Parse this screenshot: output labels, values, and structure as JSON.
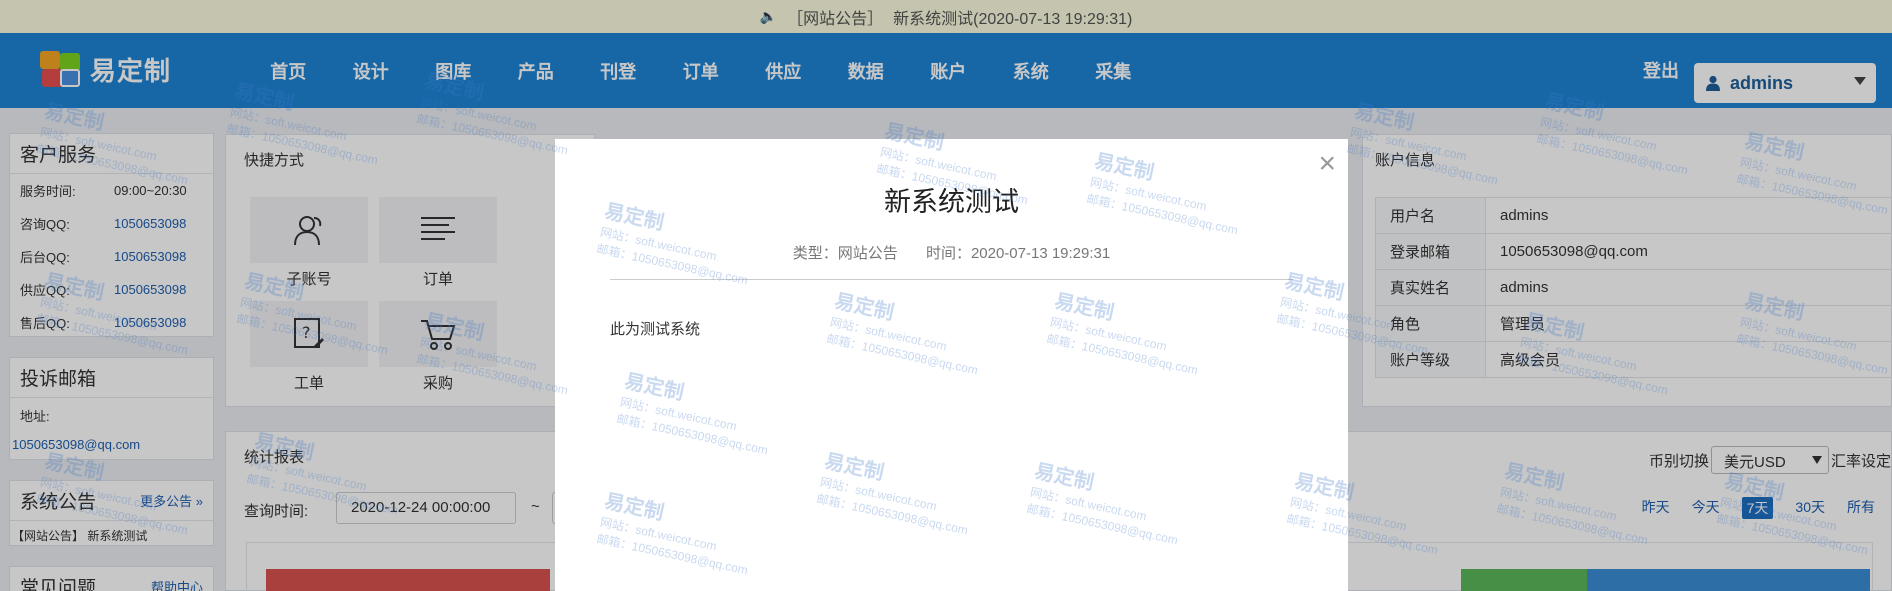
{
  "notice": {
    "tag": "［网站公告］",
    "text": "新系统测试(2020-07-13 19:29:31)"
  },
  "header": {
    "logo_text": "易定制",
    "nav": [
      "首页",
      "设计",
      "图库",
      "产品",
      "刊登",
      "订单",
      "供应",
      "数据",
      "账户",
      "系统",
      "采集"
    ],
    "logout": "登出",
    "username": "admins"
  },
  "customer_service": {
    "title": "客户服务",
    "rows": [
      {
        "k": "服务时间:",
        "v": "09:00~20:30"
      },
      {
        "k": "咨询QQ:",
        "v": "1050653098"
      },
      {
        "k": "后台QQ:",
        "v": "1050653098"
      },
      {
        "k": "供应QQ:",
        "v": "1050653098"
      },
      {
        "k": "售后QQ:",
        "v": "1050653098"
      }
    ]
  },
  "complaint": {
    "title": "投诉邮箱",
    "address_label": "地址:",
    "email": "1050653098@qq.com"
  },
  "announcement": {
    "title": "系统公告",
    "more": "更多公告",
    "item": "【网站公告】 新系统测试"
  },
  "faq": {
    "title": "常见问题",
    "help": "帮助中心"
  },
  "quick": {
    "title": "快捷方式",
    "items": [
      "子账号",
      "订单",
      "工单",
      "采购"
    ]
  },
  "stats": {
    "title": "统计报表",
    "query_label": "查询时间:",
    "date_from": "2020-12-24 00:00:00",
    "tilde": "~",
    "currency_label": "币别切换",
    "currency_value": "美元USD",
    "rate_label": "汇率设定",
    "ranges": [
      "昨天",
      "今天",
      "7天",
      "30天",
      "所有"
    ],
    "active_range": "7天"
  },
  "account": {
    "title": "账户信息",
    "rows": [
      {
        "k": "用户名",
        "v": "admins"
      },
      {
        "k": "登录邮箱",
        "v": "1050653098@qq.com"
      },
      {
        "k": "真实姓名",
        "v": "admins"
      },
      {
        "k": "角色",
        "v": "管理员"
      },
      {
        "k": "账户等级",
        "v": "高级会员"
      }
    ]
  },
  "modal": {
    "close": "×",
    "title": "新系统测试",
    "type": "类型：网站公告",
    "time": "时间：2020-07-13 19:29:31",
    "body": "此为测试系统"
  },
  "watermark": {
    "brand": "易定制",
    "site": "网站：soft.weicot.com",
    "mail": "邮箱：1050653098@qq.com"
  },
  "colors": {
    "header": "#1e85d6",
    "notice_bg": "#fdfce0",
    "link": "#1e5fb0"
  }
}
